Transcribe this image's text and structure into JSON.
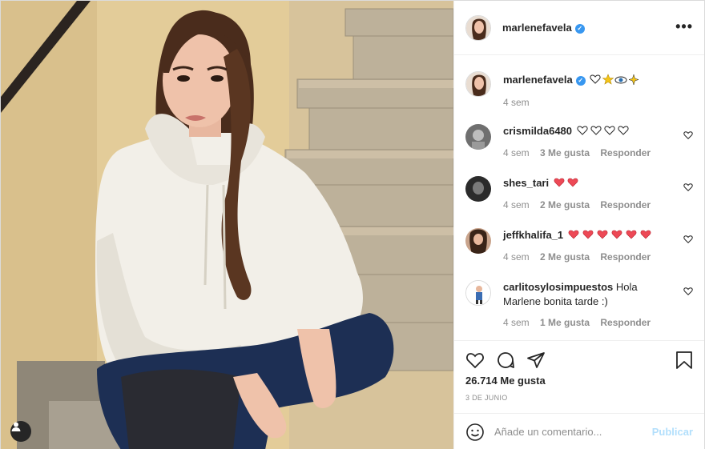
{
  "post": {
    "author": "marlenefavela",
    "verified_mark": "✓",
    "more_icon": "•••"
  },
  "caption": {
    "username": "marlenefavela",
    "emoji": [
      "white-heart",
      "star",
      "eye",
      "sparkles"
    ],
    "time": "4 sem"
  },
  "comments": [
    {
      "username": "crismilda6480",
      "text": "",
      "emoji": [
        "white-heart",
        "white-heart",
        "white-heart",
        "white-heart"
      ],
      "time": "4 sem",
      "likes": "3 Me gusta",
      "reply": "Responder"
    },
    {
      "username": "shes_tari",
      "text": "",
      "emoji": [
        "red-heart",
        "red-heart"
      ],
      "time": "4 sem",
      "likes": "2 Me gusta",
      "reply": "Responder"
    },
    {
      "username": "jeffkhalifa_1",
      "text": "",
      "emoji": [
        "red-heart",
        "red-heart",
        "red-heart",
        "red-heart",
        "red-heart",
        "red-heart"
      ],
      "time": "4 sem",
      "likes": "2 Me gusta",
      "reply": "Responder"
    },
    {
      "username": "carlitosylosimpuestos",
      "text": "Hola Marlene bonita tarde :)",
      "emoji": [],
      "time": "4 sem",
      "likes": "1 Me gusta",
      "reply": "Responder"
    }
  ],
  "actions": {
    "likes": "26.714 Me gusta",
    "date": "3 DE JUNIO"
  },
  "add_comment": {
    "placeholder": "Añade un comentario...",
    "publish": "Publicar"
  },
  "colors": {
    "verified": "#3897f0",
    "red_heart": "#ed4956",
    "publish_disabled": "#b2dffc"
  }
}
